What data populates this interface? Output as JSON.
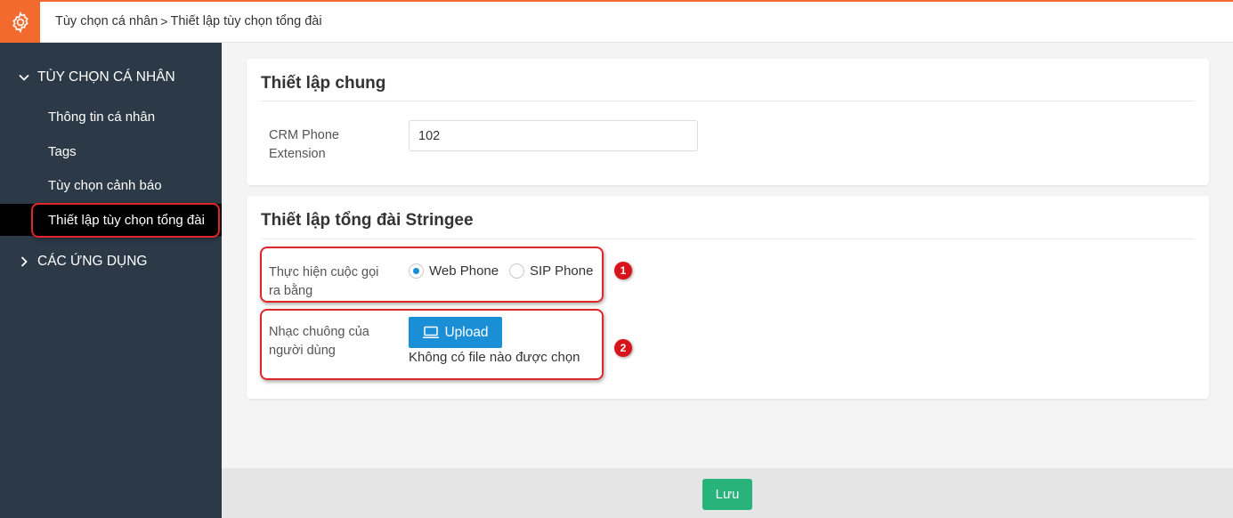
{
  "breadcrumb": {
    "parent": "Tùy chọn cá nhân",
    "separator": ">",
    "current": "Thiết lập tùy chọn tổng đài"
  },
  "sidebar": {
    "group1": "TÙY CHỌN CÁ NHÂN",
    "items": [
      {
        "label": "Thông tin cá nhân"
      },
      {
        "label": "Tags"
      },
      {
        "label": "Tùy chọn cảnh báo"
      },
      {
        "label": "Thiết lập tùy chọn tổng đài"
      }
    ],
    "group2": "CÁC ỨNG DỤNG"
  },
  "general": {
    "title": "Thiết lập chung",
    "crm_label": "CRM Phone Extension",
    "crm_value": "102"
  },
  "stringee": {
    "title": "Thiết lập tổng đài Stringee",
    "call_label": "Thực hiện cuộc gọi ra bằng",
    "options": [
      "Web Phone",
      "SIP Phone"
    ],
    "selected": "Web Phone",
    "ringtone_label": "Nhạc chuông của người dùng",
    "upload_label": "Upload",
    "no_file": "Không có file nào được chọn"
  },
  "annotations": [
    "1",
    "2"
  ],
  "footer": {
    "save_label": "Lưu"
  },
  "colors": {
    "accent": "#f26a2e",
    "sidebar": "#2c3a47",
    "primary": "#1a8fd6",
    "save": "#28b37a",
    "highlight": "#e0262a"
  }
}
